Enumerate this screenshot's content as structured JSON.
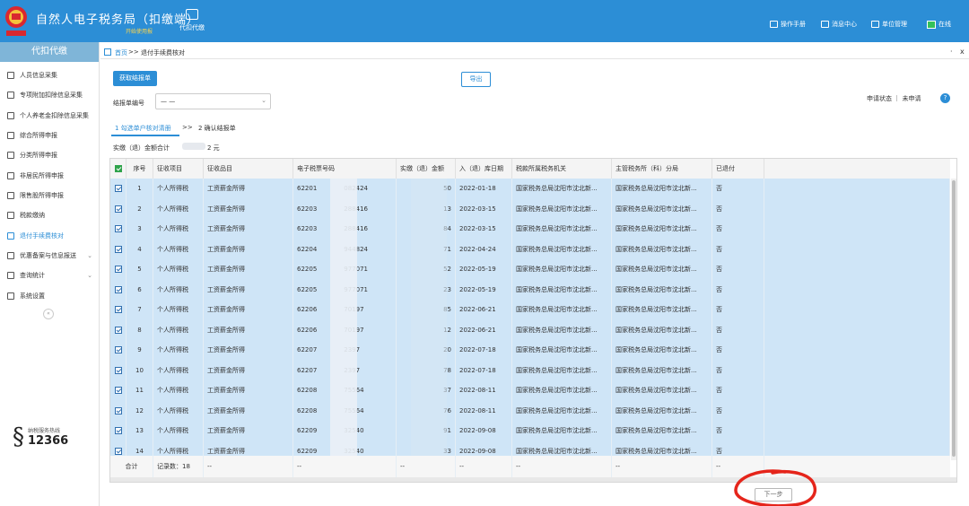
{
  "header": {
    "title": "自然人电子税务局（扣缴端）",
    "subtitle": "开始使用报",
    "nav_daikou": "代扣代缴",
    "right_items": [
      {
        "icon": "manual-icon",
        "label": "操作手册"
      },
      {
        "icon": "message-icon",
        "label": "消息中心"
      },
      {
        "icon": "unit-icon",
        "label": "单位管理"
      },
      {
        "icon": "online-icon",
        "label": "在线"
      }
    ]
  },
  "sidebar": {
    "head": "代扣代缴",
    "items": [
      {
        "label": "人员信息采集",
        "icon": "person-icon",
        "chevron": ""
      },
      {
        "label": "专项附加扣除信息采集",
        "icon": "list-icon",
        "chevron": ""
      },
      {
        "label": "个人养老金扣除信息采集",
        "icon": "doc-icon",
        "chevron": ""
      },
      {
        "label": "综合所得申报",
        "icon": "form-icon",
        "chevron": ""
      },
      {
        "label": "分类所得申报",
        "icon": "pie-icon",
        "chevron": ""
      },
      {
        "label": "非居民所得申报",
        "icon": "user-icon",
        "chevron": ""
      },
      {
        "label": "限售股所得申报",
        "icon": "bar-icon",
        "chevron": ""
      },
      {
        "label": "税款缴纳",
        "icon": "folder-icon",
        "chevron": ""
      },
      {
        "label": "退付手续费核对",
        "icon": "receipt-icon",
        "chevron": "",
        "active": true
      },
      {
        "label": "优惠备案与信息报送",
        "icon": "file-icon",
        "chevron": "⌄"
      },
      {
        "label": "查询统计",
        "icon": "search-icon",
        "chevron": "⌄"
      },
      {
        "label": "系统设置",
        "icon": "gear-icon",
        "chevron": ""
      }
    ],
    "collapse": "«",
    "hotline_caption": "纳税服务热线",
    "hotline_number": "12366"
  },
  "breadcrumb": {
    "home": "首页",
    "sep": ">>",
    "current": "退付手续费核对",
    "dot": "·",
    "close": "x"
  },
  "toolbar": {
    "fetch_label": "获取结报单",
    "export_label": "导出"
  },
  "filter": {
    "label": "结报单编号",
    "value": "— —",
    "chevron": "⌄"
  },
  "status": {
    "text": "申请状态 ｜ 未申请",
    "help": "?"
  },
  "steps": {
    "step1": "1 勾选单户核对清册",
    "arrow": ">>",
    "step2": "2 确认结报单"
  },
  "summary": {
    "label": "实缴（退）金额合计",
    "value": "2 元"
  },
  "table": {
    "headers": [
      "序号",
      "征收项目",
      "征收品目",
      "电子税票号码",
      "实缴（退）金额",
      "入（退）库日期",
      "税款所属税务机关",
      "主管税务所（科）分局",
      "已退付"
    ],
    "rows": [
      {
        "no": "1",
        "item": "个人所得税",
        "sub": "工资薪金所得",
        "ticket": "62201",
        "ticket_tail": "082424",
        "amount": "50",
        "date": "2022-01-18",
        "org": "国家税务总局沈阳市沈北新...",
        "branch": "国家税务总局沈阳市沈北新...",
        "refunded": "否"
      },
      {
        "no": "2",
        "item": "个人所得税",
        "sub": "工资薪金所得",
        "ticket": "62203",
        "ticket_tail": "288416",
        "amount": "13",
        "date": "2022-03-15",
        "org": "国家税务总局沈阳市沈北新...",
        "branch": "国家税务总局沈阳市沈北新...",
        "refunded": "否"
      },
      {
        "no": "3",
        "item": "个人所得税",
        "sub": "工资薪金所得",
        "ticket": "62203",
        "ticket_tail": "288416",
        "amount": "84",
        "date": "2022-03-15",
        "org": "国家税务总局沈阳市沈北新...",
        "branch": "国家税务总局沈阳市沈北新...",
        "refunded": "否"
      },
      {
        "no": "4",
        "item": "个人所得税",
        "sub": "工资薪金所得",
        "ticket": "62204",
        "ticket_tail": "944824",
        "amount": "71",
        "date": "2022-04-24",
        "org": "国家税务总局沈阳市沈北新...",
        "branch": "国家税务总局沈阳市沈北新...",
        "refunded": "否"
      },
      {
        "no": "5",
        "item": "个人所得税",
        "sub": "工资薪金所得",
        "ticket": "62205",
        "ticket_tail": "977071",
        "amount": "52",
        "date": "2022-05-19",
        "org": "国家税务总局沈阳市沈北新...",
        "branch": "国家税务总局沈阳市沈北新...",
        "refunded": "否"
      },
      {
        "no": "6",
        "item": "个人所得税",
        "sub": "工资薪金所得",
        "ticket": "62205",
        "ticket_tail": "977071",
        "amount": "23",
        "date": "2022-05-19",
        "org": "国家税务总局沈阳市沈北新...",
        "branch": "国家税务总局沈阳市沈北新...",
        "refunded": "否"
      },
      {
        "no": "7",
        "item": "个人所得税",
        "sub": "工资薪金所得",
        "ticket": "62206",
        "ticket_tail": "70197",
        "amount": "85",
        "date": "2022-06-21",
        "org": "国家税务总局沈阳市沈北新...",
        "branch": "国家税务总局沈阳市沈北新...",
        "refunded": "否"
      },
      {
        "no": "8",
        "item": "个人所得税",
        "sub": "工资薪金所得",
        "ticket": "62206",
        "ticket_tail": "70197",
        "amount": "12",
        "date": "2022-06-21",
        "org": "国家税务总局沈阳市沈北新...",
        "branch": "国家税务总局沈阳市沈北新...",
        "refunded": "否"
      },
      {
        "no": "9",
        "item": "个人所得税",
        "sub": "工资薪金所得",
        "ticket": "62207",
        "ticket_tail": "2397",
        "amount": "20",
        "date": "2022-07-18",
        "org": "国家税务总局沈阳市沈北新...",
        "branch": "国家税务总局沈阳市沈北新...",
        "refunded": "否"
      },
      {
        "no": "10",
        "item": "个人所得税",
        "sub": "工资薪金所得",
        "ticket": "62207",
        "ticket_tail": "2397",
        "amount": "78",
        "date": "2022-07-18",
        "org": "国家税务总局沈阳市沈北新...",
        "branch": "国家税务总局沈阳市沈北新...",
        "refunded": "否"
      },
      {
        "no": "11",
        "item": "个人所得税",
        "sub": "工资薪金所得",
        "ticket": "62208",
        "ticket_tail": "75564",
        "amount": "37",
        "date": "2022-08-11",
        "org": "国家税务总局沈阳市沈北新...",
        "branch": "国家税务总局沈阳市沈北新...",
        "refunded": "否"
      },
      {
        "no": "12",
        "item": "个人所得税",
        "sub": "工资薪金所得",
        "ticket": "62208",
        "ticket_tail": "75564",
        "amount": "76",
        "date": "2022-08-11",
        "org": "国家税务总局沈阳市沈北新...",
        "branch": "国家税务总局沈阳市沈北新...",
        "refunded": "否"
      },
      {
        "no": "13",
        "item": "个人所得税",
        "sub": "工资薪金所得",
        "ticket": "62209",
        "ticket_tail": "32540",
        "amount": "91",
        "date": "2022-09-08",
        "org": "国家税务总局沈阳市沈北新...",
        "branch": "国家税务总局沈阳市沈北新...",
        "refunded": "否"
      },
      {
        "no": "14",
        "item": "个人所得税",
        "sub": "工资薪金所得",
        "ticket": "62209",
        "ticket_tail": "32540",
        "amount": "33",
        "date": "2022-09-08",
        "org": "国家税务总局沈阳市沈北新...",
        "branch": "国家税务总局沈阳市沈北新...",
        "refunded": "否"
      }
    ],
    "footer": {
      "label": "合计",
      "count": "记录数：18",
      "dash": "--"
    }
  },
  "next_label": "下一步",
  "colors": {
    "primary": "#2c8ed6",
    "selected_row": "#cfe5f7",
    "annotation": "#e5251b"
  }
}
